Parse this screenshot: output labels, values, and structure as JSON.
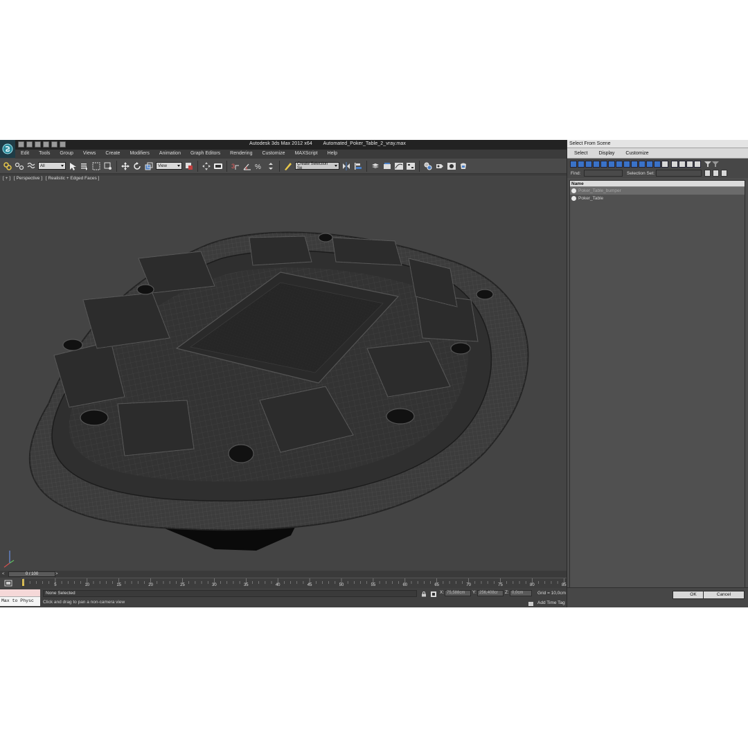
{
  "window": {
    "app_title": "Autodesk 3ds Max  2012 x64",
    "file_title": "Automated_Poker_Table_2_vray.max"
  },
  "menu": [
    "Edit",
    "Tools",
    "Group",
    "Views",
    "Create",
    "Modifiers",
    "Animation",
    "Graph Editors",
    "Rendering",
    "Customize",
    "MAXScript",
    "Help"
  ],
  "toolbar": {
    "selection_filter": "All",
    "reference_coord": "View",
    "named_selection_set": "Create Selection Se"
  },
  "viewport": {
    "label_plus": "[ + ]",
    "label_view": "[ Perspective ]",
    "label_shading": "[ Realistic + Edged Faces ]"
  },
  "timeline": {
    "slider_text": "0 / 100",
    "prev": "<",
    "next": ">",
    "ruler_numbers": [
      "5",
      "10",
      "15",
      "20",
      "25",
      "30",
      "35",
      "40",
      "45",
      "50",
      "55",
      "60",
      "65",
      "70",
      "75",
      "80",
      "85"
    ]
  },
  "status": {
    "maxscript_text": "Max to Physc",
    "selection": "None Selected",
    "prompt": "Click and drag to pan a non-camera view",
    "x_label": "X:",
    "x_value": "75,588cm",
    "y_label": "Y:",
    "y_value": "256,408cr",
    "z_label": "Z:",
    "z_value": "0,0cm",
    "grid": "Grid = 10,0cm",
    "add_time_tag": "Add Time Tag"
  },
  "dialog": {
    "title": "Select From Scene",
    "menu": [
      "Select",
      "Display",
      "Customize"
    ],
    "find_label": "Find:",
    "selection_set_label": "Selection Set:",
    "column_name": "Name",
    "items": [
      {
        "name": "Poker_Table_bumper",
        "selected": true
      },
      {
        "name": "Poker_Table",
        "selected": false
      }
    ],
    "ok": "OK",
    "cancel": "Cancel"
  },
  "colors": {
    "ui_dark": "#444444",
    "title_bar": "#222222",
    "highlight_blue": "#3a72c8",
    "timeline_key": "#e0c04a"
  }
}
